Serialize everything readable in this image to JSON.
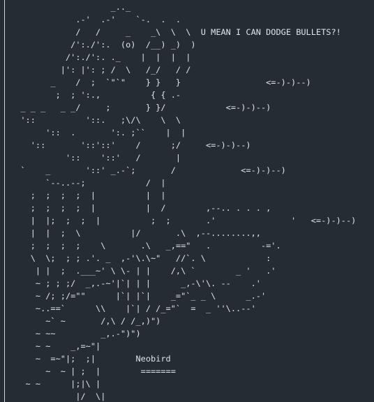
{
  "terminal": {
    "art_lines": [
      "                    _.._",
      "             .-'  .-'    `-.  .  .",
      "             /   /     _    _\\  \\  \\  U MEAN I CAN DODGE BULLETS?!",
      "            /':./':.  (o)  /__) _)  )",
      "           /':./':. ._    |  |  |  |",
      "          |': |': ; /  \\   /_/   / /",
      "        _    /  ;  `\"`\"    } }   }                 <=-)-)--)",
      "         ;  ; ':.,          { { .-",
      "  _ _ _   _ _/     ;       } }/            <=-)-)--)",
      "  '::          '::.   ;\\/\\    \\  \\",
      "       '::  .       ':. ;``    |  |",
      "    '::       '::'::'    /      ;/     <=-)-)--)",
      "           '::    '::'   /       |",
      "  `    _       '::' _.-`;       /             <=-)-)--)",
      "       `--..--;            /  |",
      "    ;  ;  ;  ;  |          |  |",
      "    ;  ;  ;  ;  |          |  /        ,--.. . . . ,",
      "    |  |;  ;  ;  |          ;  ;       .'               '   <=-)-)--)",
      "    |  |  ;  \\          |/       .\\  ,--........,,",
      "    ;  ;  ;  ;    \\       .\\   _,==\"   .          -='.",
      "    \\  \\;  ; ; .'. _  ,-'\\.\\~\"   //`. \\            :",
      "     | |  ;  .___~' \\ \\- | |    /,\\ `        _ '   .'",
      "     ~ ; ; ;/  _,.-~'|`| | |      _,-\\'\\. --    .'",
      "     ~ /; ;/=\"\"      |`| |`|    _=\"`_ _ \\      _.-'",
      "     ~..==`      \\\\    |`| / /_=\"`  =  _ ''\\..--'",
      "       ~` ~       /,\\ / /_,)\")",
      "     ~ ~~         _,.-\")\")",
      "     ~ ~    _,=~\"|",
      "     ~  =~\"|;  ;|        Neobird",
      "       ~  ~ | ;  |        =======",
      "   ~ ~      |;|\\ |",
      "             |/  \\|"
    ]
  }
}
